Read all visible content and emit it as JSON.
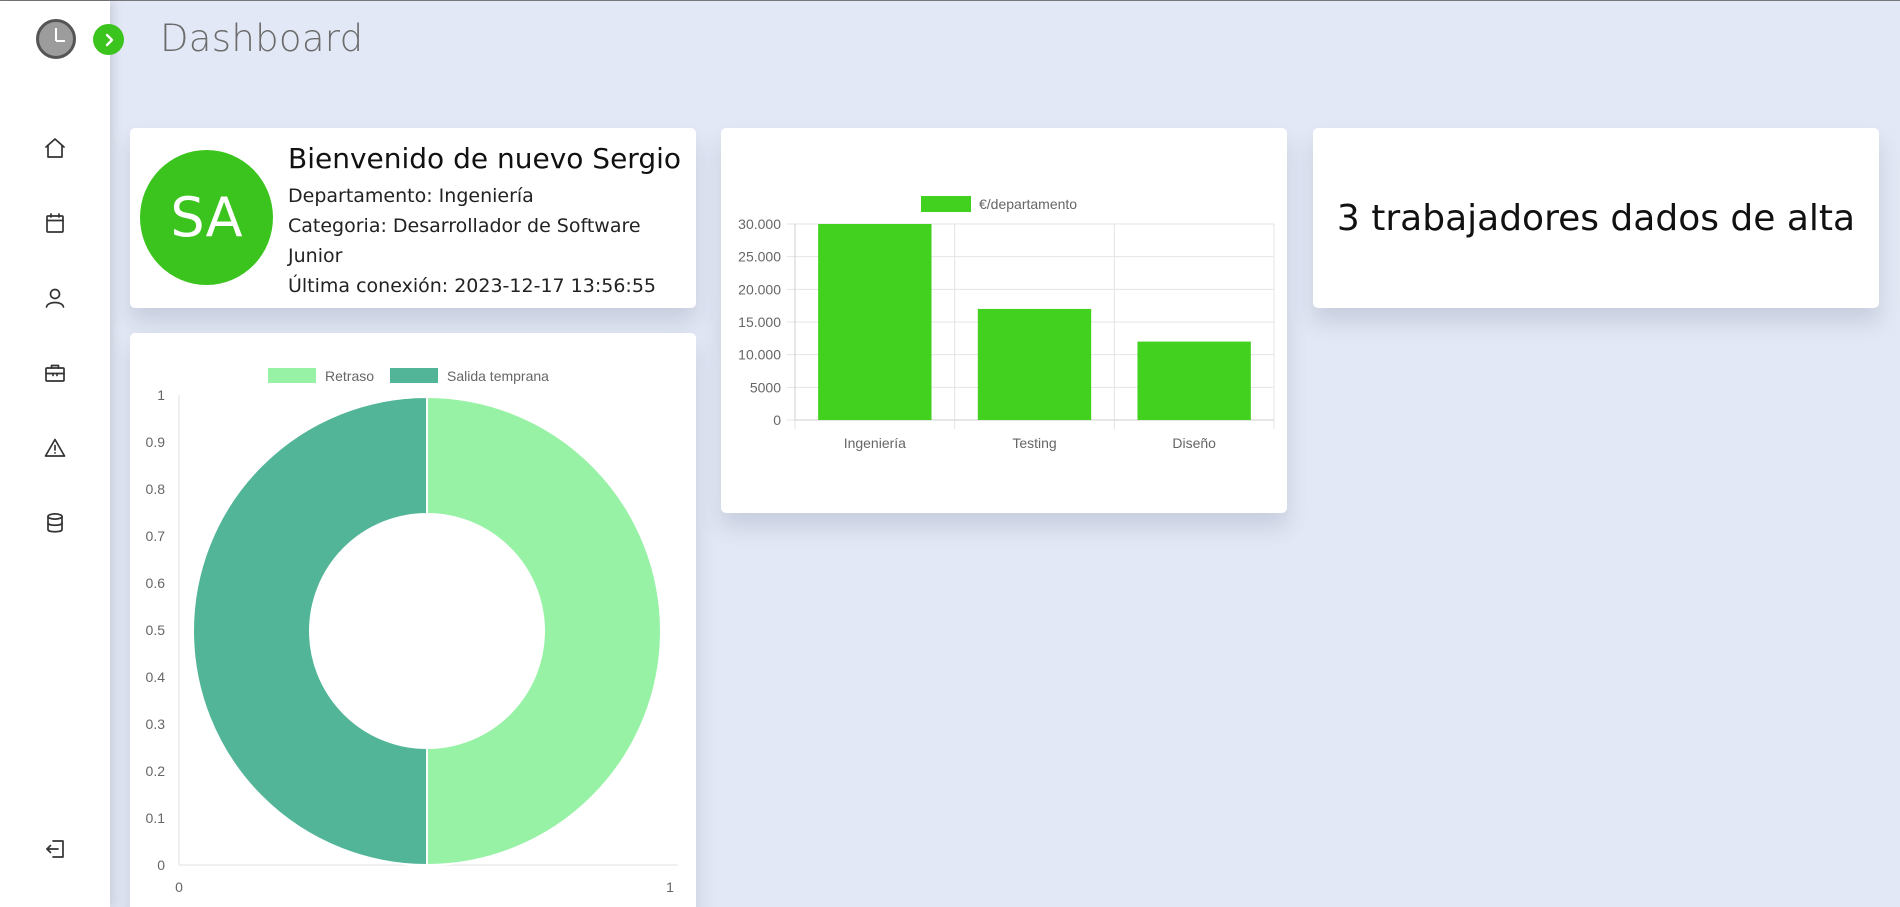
{
  "page": {
    "title": "Dashboard"
  },
  "sidebar": {
    "nav_items": [
      {
        "icon": "home-icon"
      },
      {
        "icon": "calendar-icon"
      },
      {
        "icon": "user-icon"
      },
      {
        "icon": "briefcase-icon"
      },
      {
        "icon": "warning-icon"
      },
      {
        "icon": "database-icon"
      }
    ],
    "logout_icon": "logout-icon"
  },
  "welcome": {
    "avatar_initials": "SA",
    "title": "Bienvenido de nuevo Sergio",
    "department": "Departamento: Ingeniería",
    "category": "Categoria: Desarrollador de Software Junior",
    "last_login": "Última conexión: 2023-12-17 13:56:55"
  },
  "workers": {
    "count_text": "3 trabajadores dados de alta"
  },
  "colors": {
    "accent": "#3cc41e",
    "bar": "#41d11e",
    "retraso": "#98f2a6",
    "salida_temprana": "#52b597",
    "background": "#e2e8f5"
  },
  "chart_data": [
    {
      "type": "bar",
      "legend": [
        "€/departamento"
      ],
      "legend_position": "top",
      "categories": [
        "Ingeniería",
        "Testing",
        "Diseño"
      ],
      "series": [
        {
          "name": "€/departamento",
          "values": [
            30000,
            17000,
            12000
          ]
        }
      ],
      "yticks": [
        "0",
        "5000",
        "10.000",
        "15.000",
        "20.000",
        "25.000",
        "30.000"
      ],
      "ylim": [
        0,
        30000
      ],
      "grid": true
    },
    {
      "type": "pie",
      "legend": [
        "Retraso",
        "Salida temprana"
      ],
      "legend_position": "top",
      "labels": [
        "Retraso",
        "Salida temprana"
      ],
      "values": [
        1,
        1
      ],
      "yticks": [
        "0",
        "0.1",
        "0.2",
        "0.3",
        "0.4",
        "0.5",
        "0.6",
        "0.7",
        "0.8",
        "0.9",
        "1"
      ],
      "xticks": [
        "0",
        "1"
      ],
      "ylim": [
        0,
        1
      ],
      "xlim": [
        0,
        1
      ]
    }
  ]
}
